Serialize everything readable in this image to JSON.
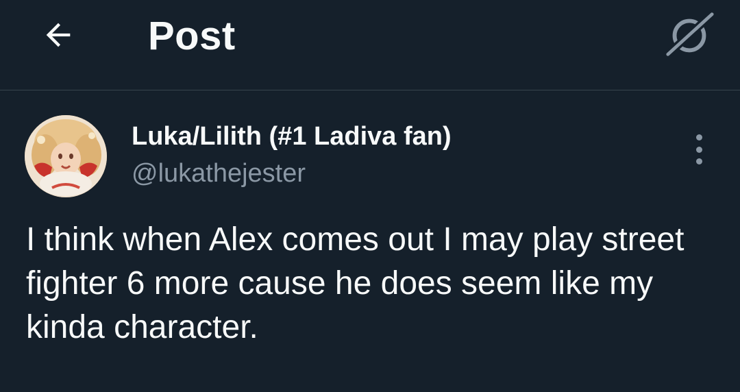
{
  "header": {
    "back_icon": "arrow-left-icon",
    "title": "Post",
    "grok_icon": "grok-icon"
  },
  "post": {
    "author": {
      "display_name": "Luka/Lilith (#1 Ladiva fan)",
      "handle": "@lukathejester",
      "avatar_icon": "avatar"
    },
    "more_icon": "more-vertical-icon",
    "text": "I think when Alex comes out I may play street fighter 6 more cause he does seem like my kinda character."
  },
  "colors": {
    "background": "#15202b",
    "text_primary": "#f7f9f9",
    "text_secondary": "#8b98a5",
    "divider": "#38444d"
  }
}
